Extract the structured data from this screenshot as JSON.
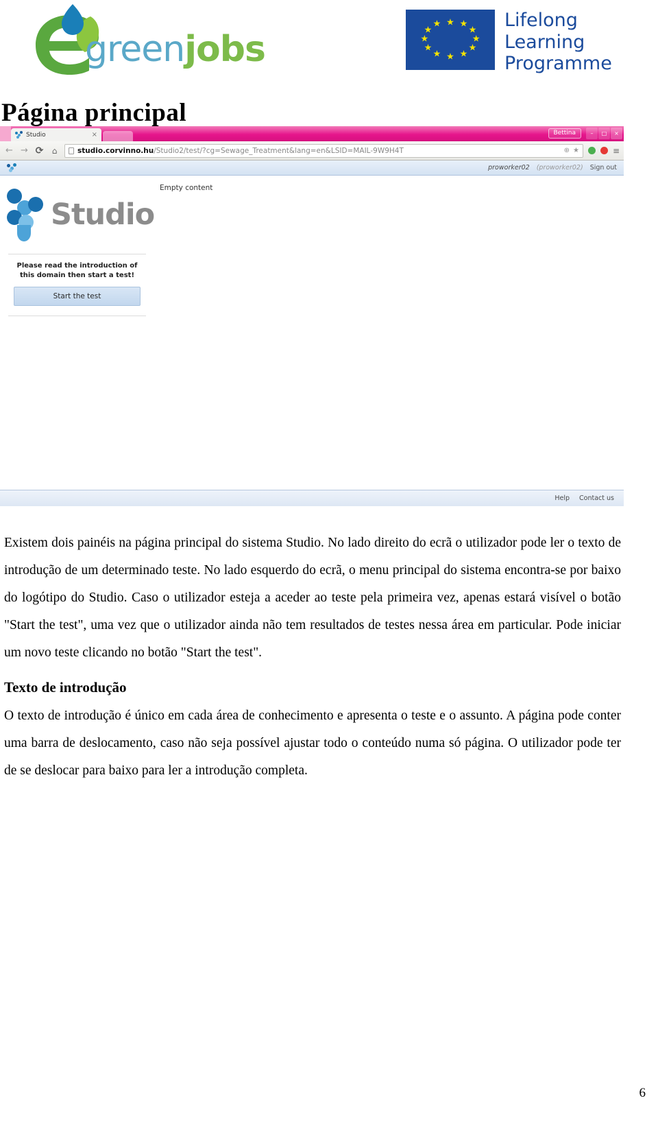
{
  "document": {
    "title": "Página principal",
    "page_number": "6"
  },
  "logos": {
    "egreenjobs": {
      "green_part": "green",
      "jobs_part": "jobs",
      "alt": "egreenjobs-logo"
    },
    "lifelong": {
      "line1": "Lifelong",
      "line2": "Learning",
      "line3": "Programme",
      "flag_alt": "eu-flag"
    }
  },
  "screenshot": {
    "browser": {
      "tab_title": "Studio",
      "tab_close": "×",
      "window_user": "Bettina",
      "minimize": "–",
      "maximize": "□",
      "close": "×",
      "back_icon": "←",
      "forward_icon": "→",
      "reload_icon": "⟳",
      "home_icon": "⌂",
      "url_host": "studio.corvinno.hu",
      "url_path": "/Studio2/test/?cg=Sewage_Treatment&lang=en&LSID=MAIL-9W9H4T",
      "zoom_icon": "⊕",
      "bookmark_icon": "★",
      "menu_icon": "≡"
    },
    "app": {
      "user_name": "proworker02",
      "user_id": "(proworker02)",
      "sign_out": "Sign out",
      "left_panel": {
        "logo_word": "Studio",
        "hint": "Please read the introduction of this domain then start a test!",
        "start_button": "Start the test"
      },
      "right_panel": {
        "empty_content": "Empty content"
      },
      "footer": {
        "help": "Help",
        "contact": "Contact us"
      }
    }
  },
  "content": {
    "paragraph_1": "Existem dois painéis na página principal do sistema Studio. No lado direito do ecrã o utilizador pode ler o texto de introdução de um determinado teste. No lado esquerdo do ecrã, o menu principal do sistema encontra-se por baixo do logótipo do Studio. Caso o utilizador esteja a aceder ao teste pela primeira vez, apenas estará visível o botão \"Start the test\", uma vez que o utilizador ainda não tem resultados de testes nessa área em particular. Pode iniciar um novo teste clicando no botão \"Start the test\".",
    "subheading": "Texto de introdução",
    "paragraph_2": "O texto de introdução é único em cada área de conhecimento e apresenta o teste e o assunto. A página pode conter uma barra de deslocamento, caso não seja possível ajustar todo o conteúdo numa só página. O utilizador pode ter de se deslocar para baixo para ler a introdução completa."
  },
  "colors": {
    "brand_green": "#7dbb4a",
    "brand_teal": "#5aa8c8",
    "eu_blue": "#1b4b9c",
    "eu_yellow": "#f5e400",
    "chrome_pink": "#e6158c",
    "studio_gray": "#8c8c8c"
  }
}
